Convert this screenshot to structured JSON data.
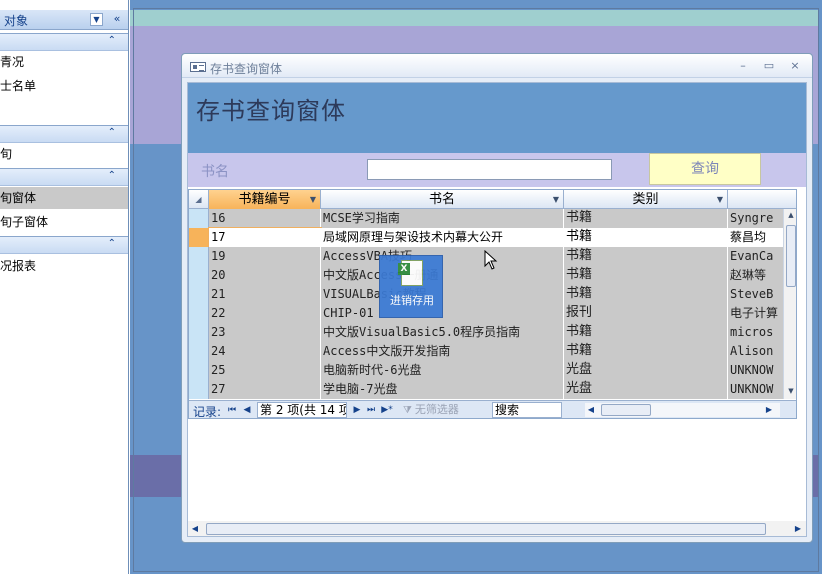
{
  "nav_pane": {
    "header_title": "对象",
    "dropdown_icon": "chevron-down-icon",
    "collapse_icon": "double-chevron-left-icon",
    "group_chevron_icon": "chevron-up-icon",
    "items": [
      {
        "label": "青况"
      },
      {
        "label": "士名单"
      },
      {
        "label": "旬"
      },
      {
        "label": "旬窗体",
        "selected": true
      },
      {
        "label": "旬子窗体"
      },
      {
        "label": "况报表"
      }
    ]
  },
  "window": {
    "title": "存书查询窗体",
    "minimize": "–",
    "restore": "▭",
    "close": "×"
  },
  "form": {
    "heading": "存书查询窗体",
    "search_label": "书名",
    "search_value": "",
    "query_button": "查询"
  },
  "datasheet": {
    "columns": [
      {
        "label": "书籍编号",
        "active": true
      },
      {
        "label": "书名"
      },
      {
        "label": "类别"
      },
      {
        "label": ""
      }
    ],
    "rows": [
      {
        "id": "16",
        "name": "MCSE学习指南",
        "category": "书籍",
        "extra": "Syngre"
      },
      {
        "id": "17",
        "name": "局域网原理与架设技术内幕大公开",
        "category": "书籍",
        "extra": "蔡昌均",
        "current": true
      },
      {
        "id": "19",
        "name": "AccessVBA技巧",
        "category": "书籍",
        "extra": "EvanCa"
      },
      {
        "id": "20",
        "name": "中文版Access一册通",
        "category": "书籍",
        "extra": "赵琳等"
      },
      {
        "id": "21",
        "name": "VISUALBasic教程",
        "category": "书籍",
        "extra": "SteveB"
      },
      {
        "id": "22",
        "name": "CHIP-01",
        "category": "报刊",
        "extra": "电子计算"
      },
      {
        "id": "23",
        "name": "中文版VisualBasic5.0程序员指南",
        "category": "书籍",
        "extra": "micros"
      },
      {
        "id": "24",
        "name": "Access中文版开发指南",
        "category": "书籍",
        "extra": "Alison"
      },
      {
        "id": "25",
        "name": "电脑新时代-6光盘",
        "category": "光盘",
        "extra": "UNKNOW"
      },
      {
        "id": "27",
        "name": "学电脑-7光盘",
        "category": "光盘",
        "extra": "UNKNOW"
      }
    ]
  },
  "record_nav": {
    "label": "记录:",
    "first": "⏮",
    "prev": "◀",
    "counter": "第 2 项(共 14 项",
    "next": "▶",
    "last": "⏭",
    "filter_label": "无筛选器",
    "search_value": "搜索"
  },
  "drag_object": {
    "label": "进销存用",
    "icon": "excel-file-icon"
  },
  "colors": {
    "workspace": "#6794c8",
    "form_header": "#6699cc",
    "search_strip": "#c8c6ec",
    "query_button": "#ffffc6",
    "active_column": "#f7b35a"
  }
}
